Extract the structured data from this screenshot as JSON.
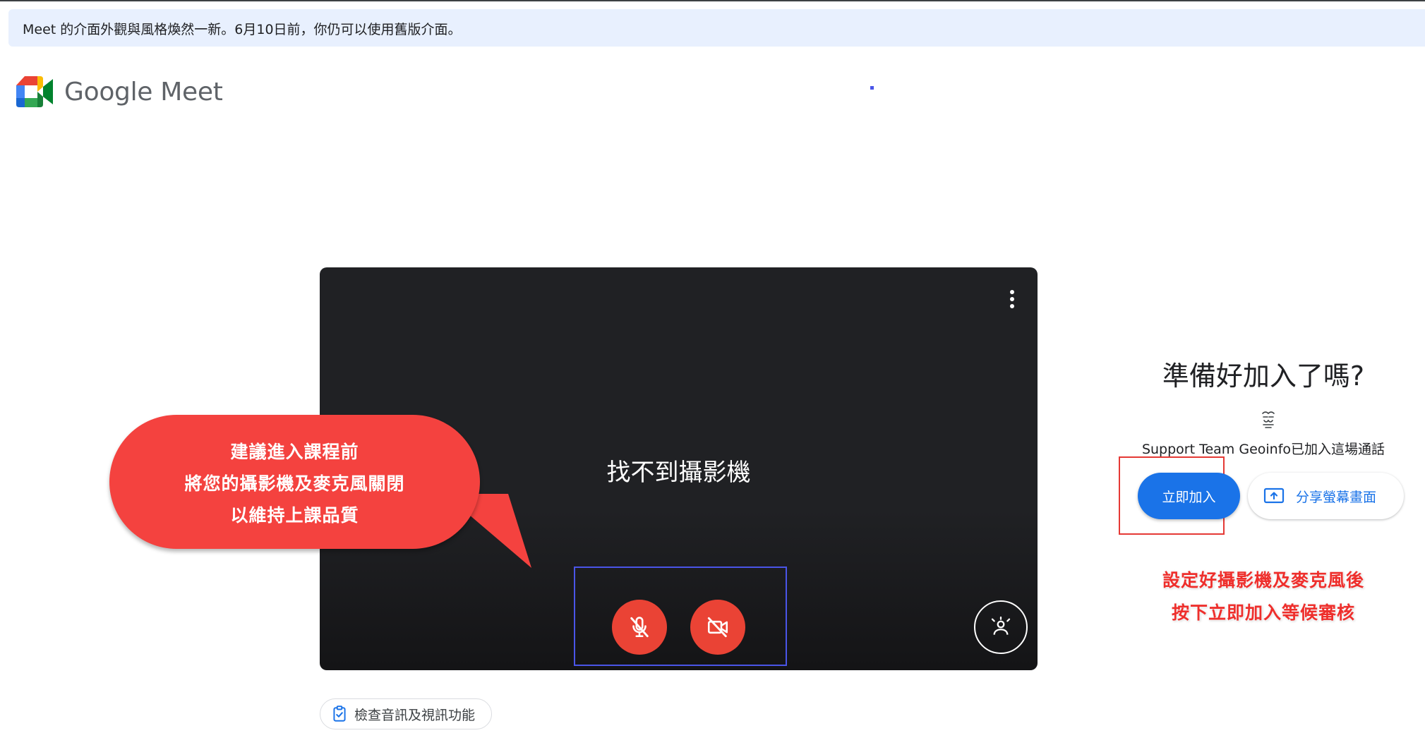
{
  "banner": {
    "text": "Meet 的介面外觀與風格煥然一新。6月10日前，你仍可以使用舊版介面。"
  },
  "brand": {
    "logo_text": "Google Meet"
  },
  "preview": {
    "no_camera_text": "找不到攝影機",
    "mic_state": "off",
    "camera_state": "off"
  },
  "annotations": {
    "bubble_lines": [
      "建議進入課程前",
      "將您的攝影機及麥克風關閉",
      "以維持上課品質"
    ],
    "note_lines": [
      "設定好攝影機及麥克風後",
      "按下立即加入等候審核"
    ]
  },
  "check_av": {
    "label": "檢查音訊及視訊功能"
  },
  "join_panel": {
    "title": "準備好加入了嗎?",
    "participant_text": "Support Team Geoinfo已加入這場通話",
    "join_label": "立即加入",
    "share_label": "分享螢幕畫面"
  },
  "colors": {
    "accent": "#1a73e8",
    "danger": "#ea4335",
    "banner_bg": "#e8f0fe",
    "bubble": "#f4423f",
    "highlight_blue": "#4a55e8"
  }
}
